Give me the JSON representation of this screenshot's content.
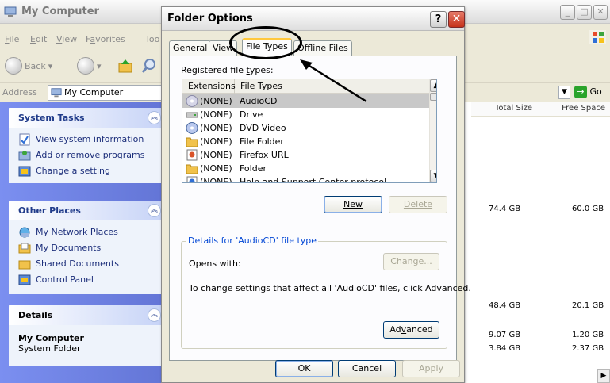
{
  "background_window": {
    "title": "My Computer",
    "menu": [
      {
        "pre": "",
        "u": "F",
        "post": "ile"
      },
      {
        "pre": "",
        "u": "E",
        "post": "dit"
      },
      {
        "pre": "",
        "u": "V",
        "post": "iew"
      },
      {
        "pre": "F",
        "u": "a",
        "post": "vorites"
      },
      {
        "pre": "",
        "u": "",
        "post": "Too"
      }
    ],
    "back_label": "Back",
    "address_label": "Address",
    "address_value": "My Computer",
    "go_label": "Go",
    "columns": {
      "total_size": "Total Size",
      "free_space": "Free Space"
    },
    "drive_sizes": [
      {
        "total": "74.4 GB",
        "free": "60.0 GB"
      },
      {
        "total": "48.4 GB",
        "free": "20.1 GB"
      },
      {
        "total": "9.07 GB",
        "free": "1.20 GB"
      },
      {
        "total": "3.84 GB",
        "free": "2.37 GB"
      }
    ],
    "system_tasks": {
      "title": "System Tasks",
      "items": [
        "View system information",
        "Add or remove programs",
        "Change a setting"
      ]
    },
    "other_places": {
      "title": "Other Places",
      "items": [
        "My Network Places",
        "My Documents",
        "Shared Documents",
        "Control Panel"
      ]
    },
    "details": {
      "title": "Details",
      "name": "My Computer",
      "kind": "System Folder"
    }
  },
  "dialog": {
    "title": "Folder Options",
    "help_glyph": "?",
    "close_glyph": "✕",
    "tabs": [
      "General",
      "View",
      "File Types",
      "Offline Files"
    ],
    "active_tab": "File Types",
    "registered_label_pre": "Registered file ",
    "registered_label_u": "t",
    "registered_label_post": "ypes:",
    "list_columns": [
      "Extensions",
      "File Types"
    ],
    "file_types": [
      {
        "ext": "(NONE)",
        "type": "AudioCD",
        "icon": "cd-audio-icon",
        "selected": true
      },
      {
        "ext": "(NONE)",
        "type": "Drive",
        "icon": "drive-icon",
        "selected": false
      },
      {
        "ext": "(NONE)",
        "type": "DVD Video",
        "icon": "dvd-icon",
        "selected": false
      },
      {
        "ext": "(NONE)",
        "type": "File Folder",
        "icon": "folder-icon",
        "selected": false
      },
      {
        "ext": "(NONE)",
        "type": "Firefox URL",
        "icon": "url-icon",
        "selected": false
      },
      {
        "ext": "(NONE)",
        "type": "Folder",
        "icon": "folder-icon",
        "selected": false
      },
      {
        "ext": "(NONE)",
        "type": "Help and Support Center protocol",
        "icon": "help-icon",
        "selected": false
      }
    ],
    "new_button": "New",
    "delete_button": "Delete",
    "details_group_title": "Details for 'AudioCD' file type",
    "opens_with_label": "Opens with:",
    "change_button": "Change...",
    "advanced_note": "To change settings that affect all 'AudioCD' files, click Advanced.",
    "advanced_button_pre": "Ad",
    "advanced_button_u": "v",
    "advanced_button_post": "anced",
    "ok_button": "OK",
    "cancel_button": "Cancel",
    "apply_button": "Apply"
  },
  "colors": {
    "xp_blue_text": "#0046d5",
    "task_pane": "#6375d6",
    "selection_gray": "#c8c8c8",
    "annotation": "#000000"
  }
}
